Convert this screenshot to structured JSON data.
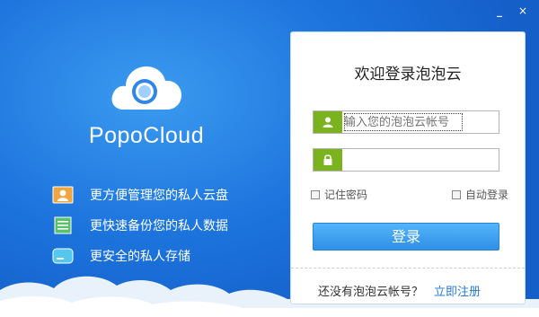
{
  "window": {
    "minimize_glyph": "_",
    "close_glyph": "×"
  },
  "brand": {
    "name": "PopoCloud"
  },
  "features": [
    {
      "label": "更方便管理您的私人云盘",
      "icon": "user-card-icon"
    },
    {
      "label": "更快速备份您的私人数据",
      "icon": "document-icon"
    },
    {
      "label": "更安全的私人存储",
      "icon": "drive-icon"
    }
  ],
  "login": {
    "title": "欢迎登录泡泡云",
    "username_placeholder": "输入您的泡泡云帐号",
    "username_value": "",
    "password_value": "",
    "remember_label": "记住密码",
    "autologin_label": "自动登录",
    "submit_label": "登录",
    "no_account_text": "还没有泡泡云帐号？",
    "register_label": "立即注册"
  },
  "colors": {
    "background_blue": "#1d74dd",
    "field_tag_green": "#7bb31e",
    "button_blue": "#3a9bef",
    "link_blue": "#2a7ad6"
  }
}
